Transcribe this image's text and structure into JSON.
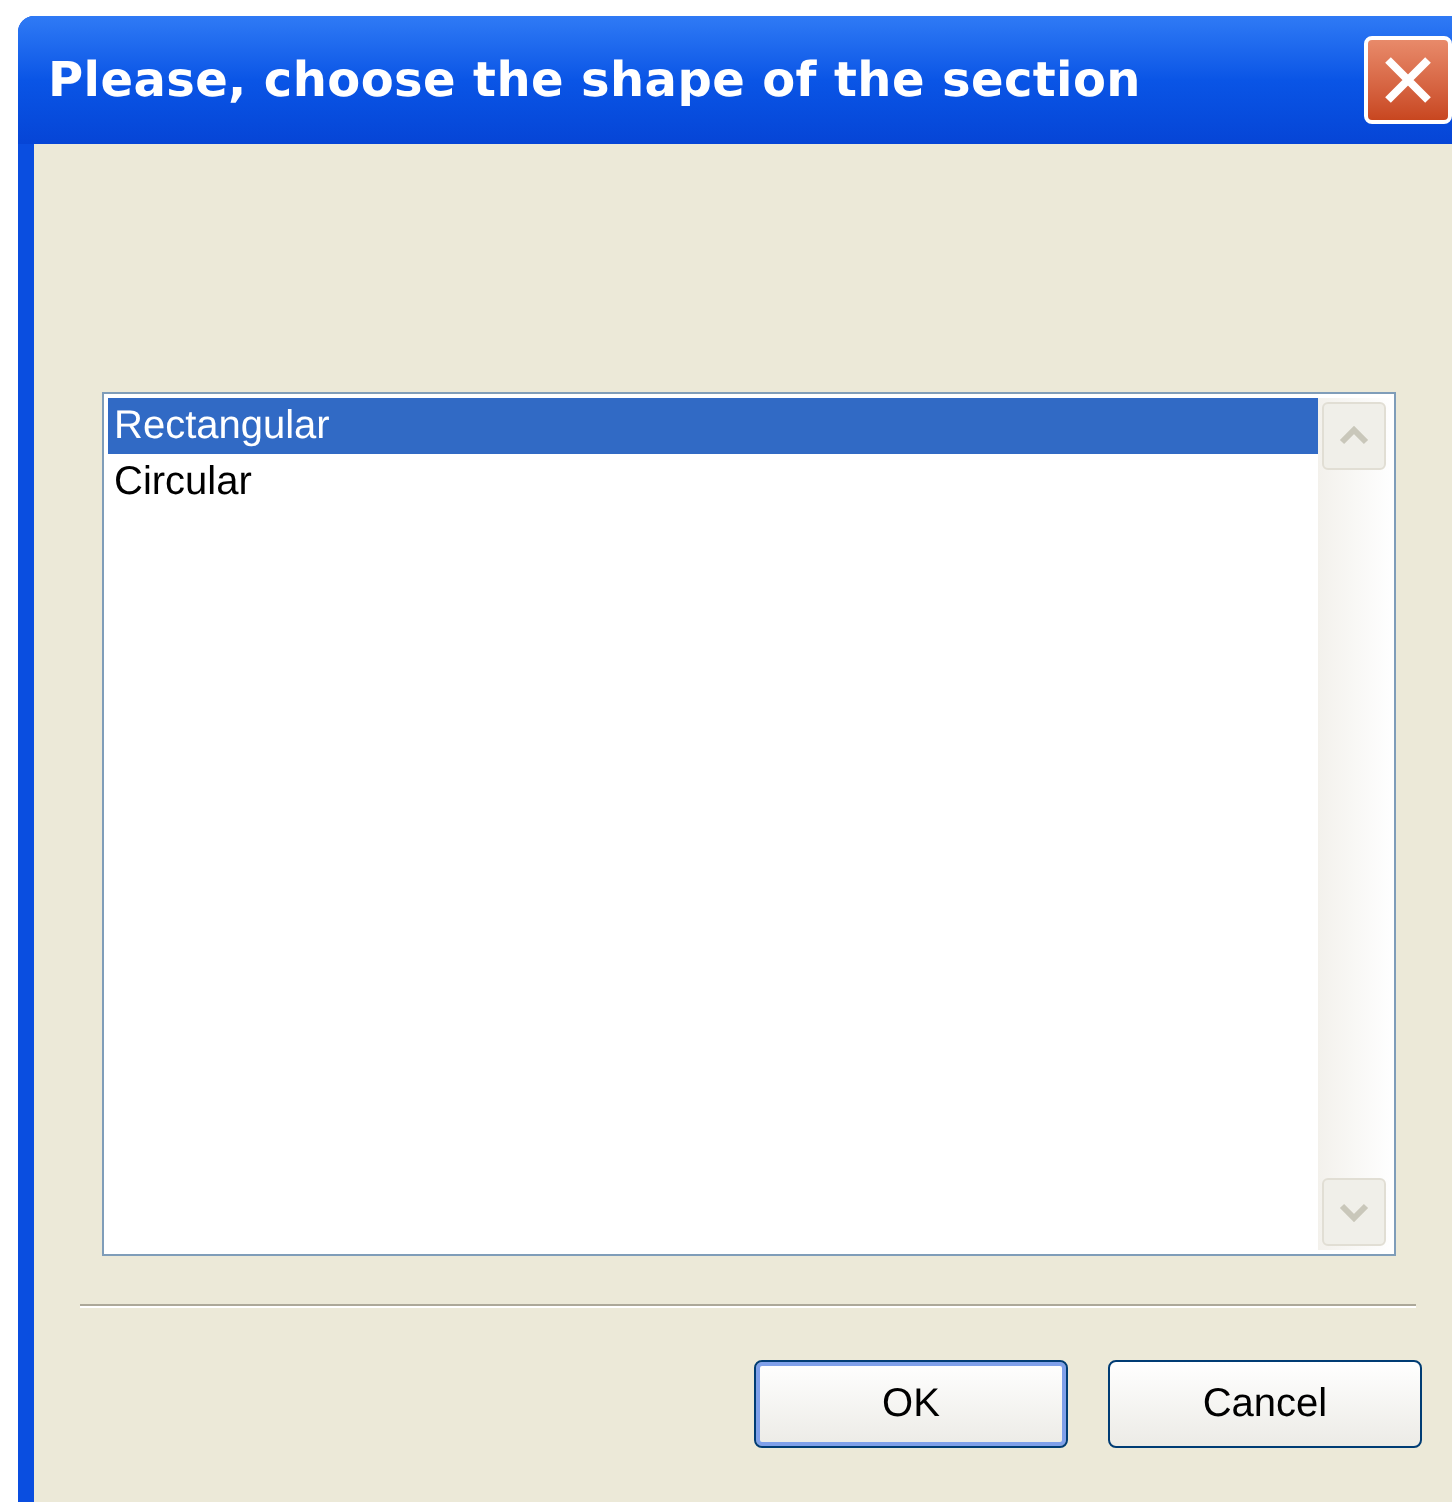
{
  "window": {
    "title": "Please, choose the shape of the section"
  },
  "list": {
    "items": [
      {
        "label": "Rectangular",
        "selected": true
      },
      {
        "label": "Circular",
        "selected": false
      }
    ]
  },
  "buttons": [
    {
      "label": "OK",
      "default": true
    },
    {
      "label": "Cancel",
      "default": false
    }
  ]
}
